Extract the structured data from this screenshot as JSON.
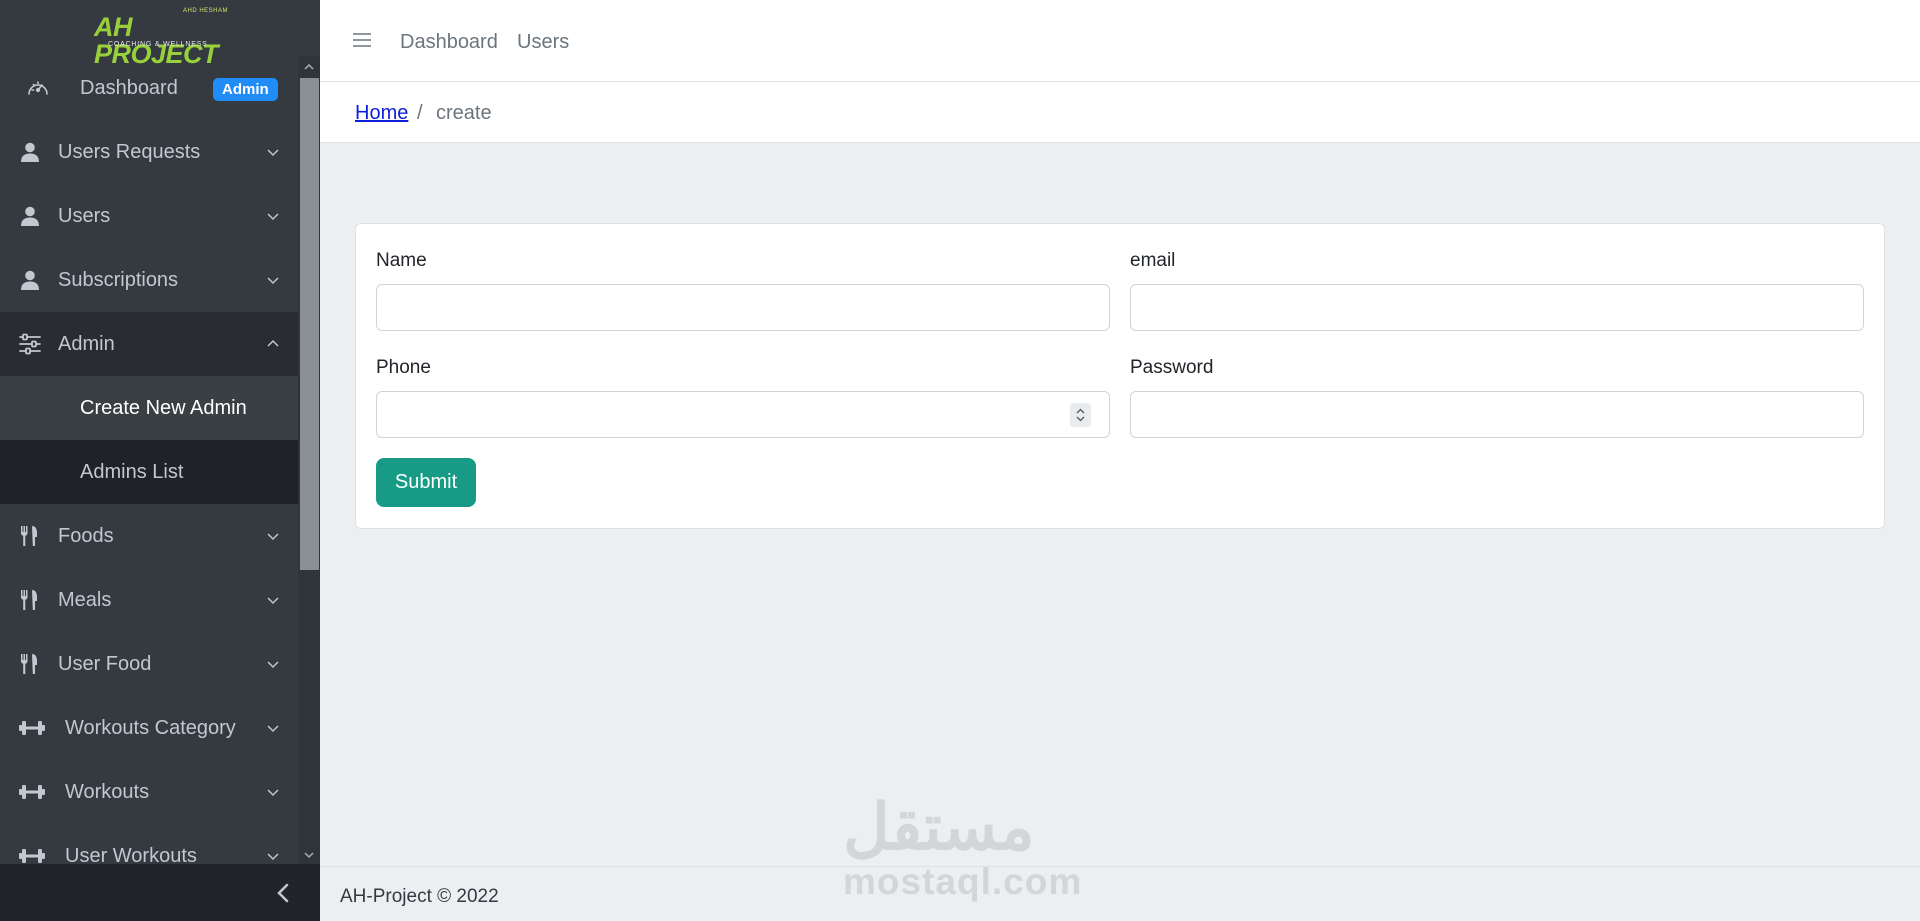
{
  "brand": {
    "small_text": "AHD HESHAM",
    "main_text": "AH PROJECT",
    "sub_text": "COACHING & WELLNESS"
  },
  "sidebar": {
    "dashboard": {
      "label": "Dashboard",
      "badge": "Admin",
      "icon": "speedometer-icon"
    },
    "items": [
      {
        "label": "Users Requests",
        "icon": "user-icon",
        "expanded": false
      },
      {
        "label": "Users",
        "icon": "user-icon",
        "expanded": false
      },
      {
        "label": "Subscriptions",
        "icon": "user-icon",
        "expanded": false
      },
      {
        "label": "Admin",
        "icon": "sliders-icon",
        "expanded": true,
        "children": [
          {
            "label": "Create New Admin",
            "current": true
          },
          {
            "label": "Admins List",
            "current": false
          }
        ]
      },
      {
        "label": "Foods",
        "icon": "utensils-icon",
        "expanded": false
      },
      {
        "label": "Meals",
        "icon": "utensils-icon",
        "expanded": false
      },
      {
        "label": "User Food",
        "icon": "utensils-icon",
        "expanded": false
      },
      {
        "label": "Workouts Category",
        "icon": "dumbbell-icon",
        "expanded": false
      },
      {
        "label": "Workouts",
        "icon": "dumbbell-icon",
        "expanded": false
      },
      {
        "label": "User Workouts",
        "icon": "dumbbell-icon",
        "expanded": false
      }
    ]
  },
  "topnav": {
    "links": [
      "Dashboard",
      "Users"
    ]
  },
  "breadcrumb": {
    "home": "Home",
    "separator": "/",
    "current": "create"
  },
  "form": {
    "name": {
      "label": "Name",
      "value": ""
    },
    "email": {
      "label": "email",
      "value": ""
    },
    "phone": {
      "label": "Phone",
      "value": ""
    },
    "password": {
      "label": "Password",
      "value": ""
    },
    "submit_label": "Submit"
  },
  "footer": {
    "text": "AH-Project © 2022"
  },
  "watermark": {
    "arabic": "مستقل",
    "latin": "mostaql.com"
  },
  "colors": {
    "sidebar_bg": "#343a40",
    "badge_bg": "#1f8cf7",
    "submit_bg": "#179b86",
    "link": "#0d1fd8",
    "logo_green": "#98d03b"
  }
}
